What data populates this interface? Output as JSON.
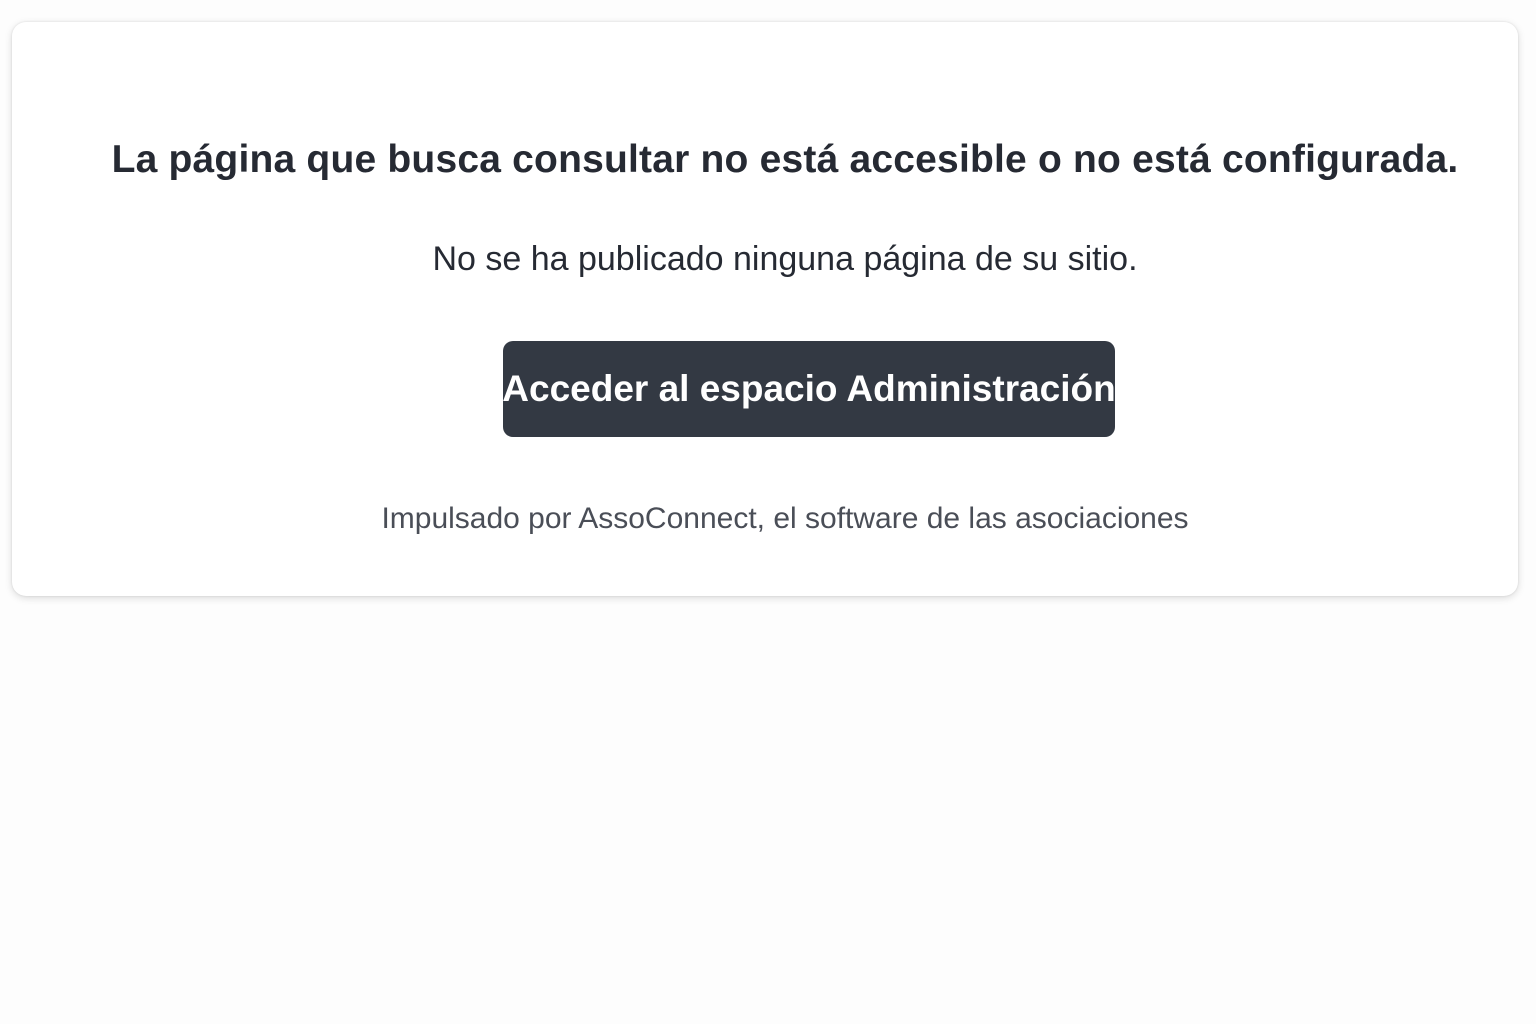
{
  "card": {
    "headline": "La página que busca consultar no está accesible o no está configurada.",
    "message": "No se ha publicado ninguna página de su sitio.",
    "admin_button_label": "Acceder al espacio Administración",
    "footer_credit": "Impulsado por AssoConnect, el software de las asociaciones"
  },
  "colors": {
    "background": "#fdfdfd",
    "card": "#ffffff",
    "text": "#262a33",
    "button": "#333943",
    "button_text": "#ffffff",
    "muted_text": "#4a4e57"
  }
}
